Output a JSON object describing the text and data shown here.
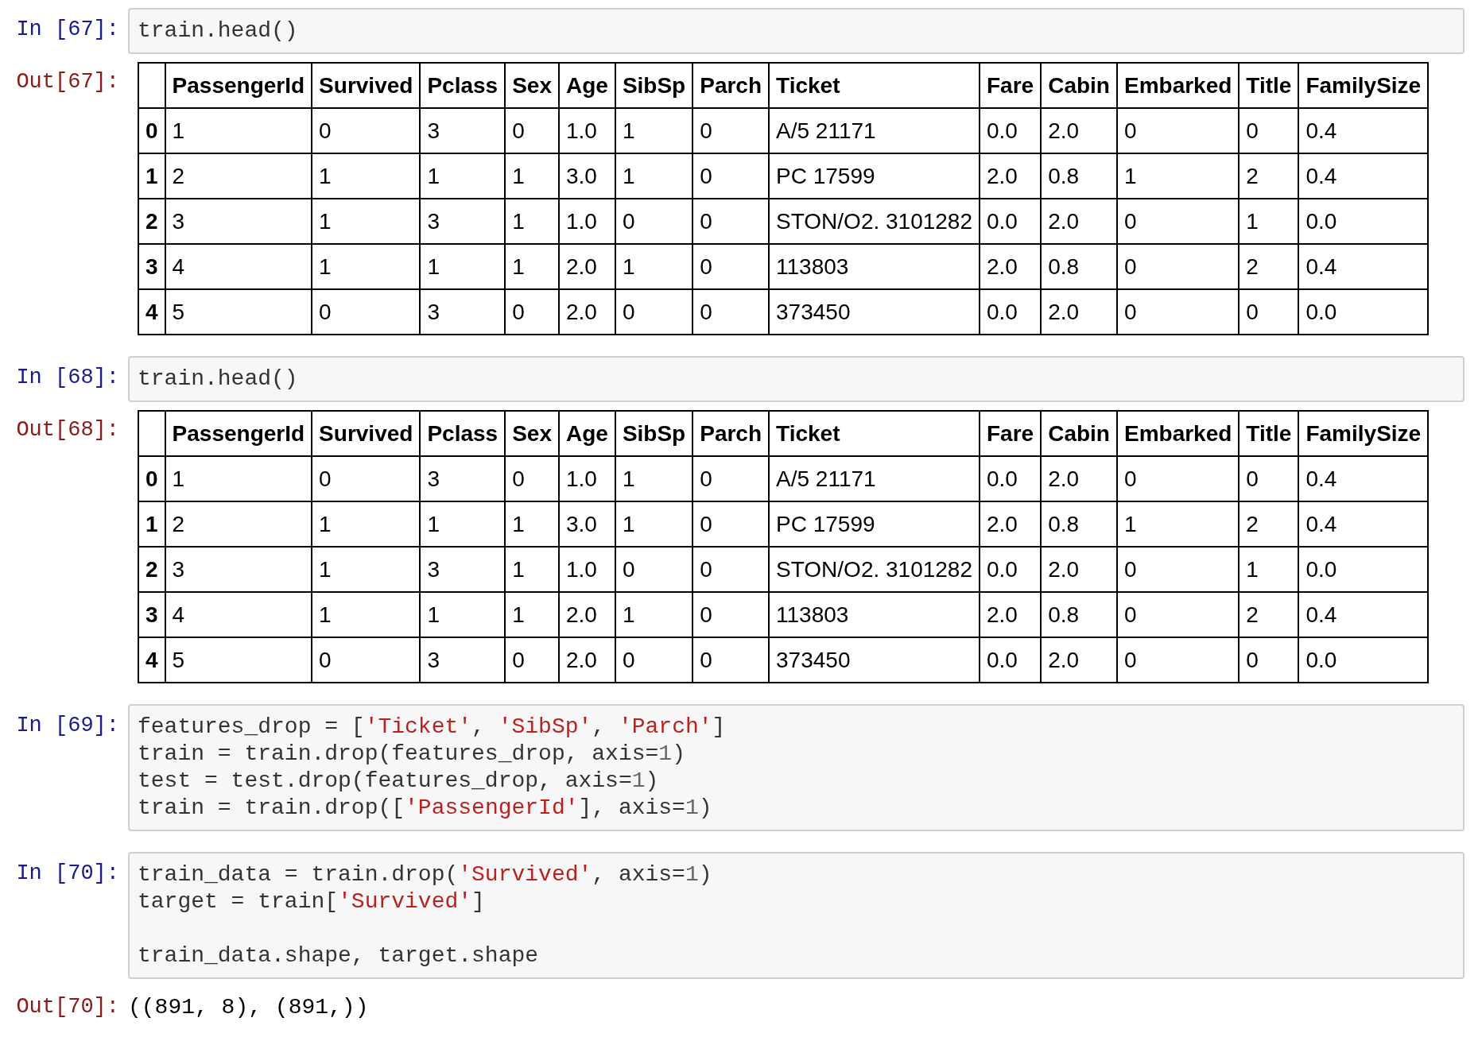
{
  "cells": [
    {
      "in_prompt": "In [67]:",
      "code": [
        [
          {
            "kind": "plain",
            "text": "train.head()"
          }
        ]
      ],
      "output": {
        "prompt": "Out[67]:",
        "kind": "table",
        "columns": [
          "",
          "PassengerId",
          "Survived",
          "Pclass",
          "Sex",
          "Age",
          "SibSp",
          "Parch",
          "Ticket",
          "Fare",
          "Cabin",
          "Embarked",
          "Title",
          "FamilySize"
        ],
        "rows": [
          {
            "index": "0",
            "values": [
              "1",
              "0",
              "3",
              "0",
              "1.0",
              "1",
              "0",
              "A/5 21171",
              "0.0",
              "2.0",
              "0",
              "0",
              "0.4"
            ]
          },
          {
            "index": "1",
            "values": [
              "2",
              "1",
              "1",
              "1",
              "3.0",
              "1",
              "0",
              "PC 17599",
              "2.0",
              "0.8",
              "1",
              "2",
              "0.4"
            ]
          },
          {
            "index": "2",
            "values": [
              "3",
              "1",
              "3",
              "1",
              "1.0",
              "0",
              "0",
              "STON/O2. 3101282",
              "0.0",
              "2.0",
              "0",
              "1",
              "0.0"
            ]
          },
          {
            "index": "3",
            "values": [
              "4",
              "1",
              "1",
              "1",
              "2.0",
              "1",
              "0",
              "113803",
              "2.0",
              "0.8",
              "0",
              "2",
              "0.4"
            ]
          },
          {
            "index": "4",
            "values": [
              "5",
              "0",
              "3",
              "0",
              "2.0",
              "0",
              "0",
              "373450",
              "0.0",
              "2.0",
              "0",
              "0",
              "0.0"
            ]
          }
        ]
      }
    },
    {
      "in_prompt": "In [68]:",
      "code": [
        [
          {
            "kind": "plain",
            "text": "train.head()"
          }
        ]
      ],
      "output": {
        "prompt": "Out[68]:",
        "kind": "table",
        "columns": [
          "",
          "PassengerId",
          "Survived",
          "Pclass",
          "Sex",
          "Age",
          "SibSp",
          "Parch",
          "Ticket",
          "Fare",
          "Cabin",
          "Embarked",
          "Title",
          "FamilySize"
        ],
        "rows": [
          {
            "index": "0",
            "values": [
              "1",
              "0",
              "3",
              "0",
              "1.0",
              "1",
              "0",
              "A/5 21171",
              "0.0",
              "2.0",
              "0",
              "0",
              "0.4"
            ]
          },
          {
            "index": "1",
            "values": [
              "2",
              "1",
              "1",
              "1",
              "3.0",
              "1",
              "0",
              "PC 17599",
              "2.0",
              "0.8",
              "1",
              "2",
              "0.4"
            ]
          },
          {
            "index": "2",
            "values": [
              "3",
              "1",
              "3",
              "1",
              "1.0",
              "0",
              "0",
              "STON/O2. 3101282",
              "0.0",
              "2.0",
              "0",
              "1",
              "0.0"
            ]
          },
          {
            "index": "3",
            "values": [
              "4",
              "1",
              "1",
              "1",
              "2.0",
              "1",
              "0",
              "113803",
              "2.0",
              "0.8",
              "0",
              "2",
              "0.4"
            ]
          },
          {
            "index": "4",
            "values": [
              "5",
              "0",
              "3",
              "0",
              "2.0",
              "0",
              "0",
              "373450",
              "0.0",
              "2.0",
              "0",
              "0",
              "0.0"
            ]
          }
        ]
      }
    },
    {
      "in_prompt": "In [69]:",
      "code": [
        [
          {
            "kind": "plain",
            "text": "features_drop = ["
          },
          {
            "kind": "string",
            "text": "'Ticket'"
          },
          {
            "kind": "plain",
            "text": ", "
          },
          {
            "kind": "string",
            "text": "'SibSp'"
          },
          {
            "kind": "plain",
            "text": ", "
          },
          {
            "kind": "string",
            "text": "'Parch'"
          },
          {
            "kind": "plain",
            "text": "]"
          }
        ],
        [
          {
            "kind": "plain",
            "text": "train = train.drop(features_drop, axis="
          },
          {
            "kind": "number",
            "text": "1"
          },
          {
            "kind": "plain",
            "text": ")"
          }
        ],
        [
          {
            "kind": "plain",
            "text": "test = test.drop(features_drop, axis="
          },
          {
            "kind": "number",
            "text": "1"
          },
          {
            "kind": "plain",
            "text": ")"
          }
        ],
        [
          {
            "kind": "plain",
            "text": "train = train.drop(["
          },
          {
            "kind": "string",
            "text": "'PassengerId'"
          },
          {
            "kind": "plain",
            "text": "], axis="
          },
          {
            "kind": "number",
            "text": "1"
          },
          {
            "kind": "plain",
            "text": ")"
          }
        ]
      ]
    },
    {
      "in_prompt": "In [70]:",
      "code": [
        [
          {
            "kind": "plain",
            "text": "train_data = train.drop("
          },
          {
            "kind": "string",
            "text": "'Survived'"
          },
          {
            "kind": "plain",
            "text": ", axis="
          },
          {
            "kind": "number",
            "text": "1"
          },
          {
            "kind": "plain",
            "text": ")"
          }
        ],
        [
          {
            "kind": "plain",
            "text": "target = train["
          },
          {
            "kind": "string",
            "text": "'Survived'"
          },
          {
            "kind": "plain",
            "text": "]"
          }
        ],
        {
          "blank_line_before": true,
          "tokens": [
            {
              "kind": "plain",
              "text": "train_data.shape, target.shape"
            }
          ]
        }
      ],
      "output": {
        "prompt": "Out[70]:",
        "kind": "text",
        "text": "((891, 8), (891,))"
      }
    }
  ]
}
